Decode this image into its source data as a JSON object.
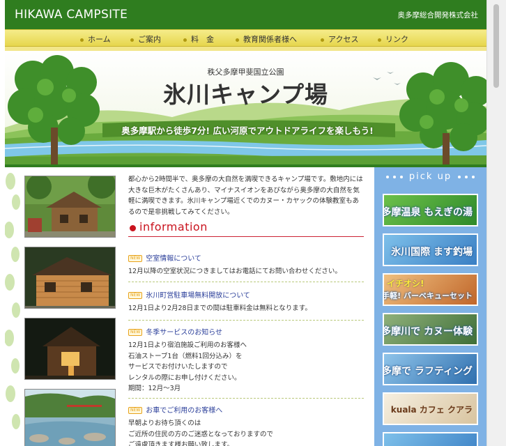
{
  "header": {
    "site_title": "HIKAWA CAMPSITE",
    "company": "奥多摩総合開発株式会社"
  },
  "nav": [
    {
      "label": "ホーム"
    },
    {
      "label": "ご案内"
    },
    {
      "label": "料　金"
    },
    {
      "label": "教育関係者様へ"
    },
    {
      "label": "アクセス"
    },
    {
      "label": "リンク"
    }
  ],
  "banner": {
    "park": "秩父多摩甲斐国立公園",
    "name": "氷川キャンプ場",
    "tagline": "奥多摩駅から徒歩7分! 広い河原でアウトドアライフを楽しもう!"
  },
  "main": {
    "intro": "都心から2時間半で、奥多摩の大自然を満喫できるキャンプ場です。敷地内には大きな巨木がたくさんあり、マイナスイオンをあびながら奥多摩の大自然を気軽に満喫できます。氷川キャンプ場近くでのカヌー・カヤックの体験教室もあるので是非挑戦してみてください。",
    "info_heading": "information",
    "badge": "NEW",
    "news": [
      {
        "title": "空室情報について",
        "body": [
          "12月以降の空室状況につきましてはお電話にてお問い合わせください。"
        ]
      },
      {
        "title": "氷川町営駐車場無料開放について",
        "body": [
          "12月1日より2月28日までの間は駐車料金は無料となります。"
        ]
      },
      {
        "title": "冬季サービスのお知らせ",
        "body": [
          "12月1日より宿泊施設ご利用のお客様へ",
          "石油ストーブ1台（燃料1回分込み）を",
          "サービスでお付けいたしますので",
          "レンタルの際にお申し付けください。",
          "期間：12月〜3月"
        ]
      },
      {
        "title": "お車でご利用のお客様へ",
        "body": [
          "早朝よりお待ち頂くのは",
          "ご近所の住民の方のご迷惑となっておりますので",
          "ご遠慮頂きます様お願い致します。"
        ]
      }
    ]
  },
  "pickup": {
    "heading": "pick up",
    "items": [
      {
        "label": "奥多摩温泉 もえぎの湯",
        "color": "#3f9a38"
      },
      {
        "label": "氷川国際 ます釣場",
        "color": "#4f8fcf"
      },
      {
        "label": "お手軽! バーベキューセット",
        "sub": "イチオシ!",
        "color": "#d9803a"
      },
      {
        "label": "多摩川で カヌー体験",
        "color": "#5d8a48"
      },
      {
        "label": "奥多摩で ラフティング",
        "color": "#3f7fbf"
      },
      {
        "label": "kuala カフェ クアラ",
        "color": "#9a5a2a"
      }
    ]
  },
  "colors": {
    "header_green": "#2f7d1f",
    "nav_yellow": "#f5ec8a",
    "info_red": "#c9131e",
    "link_blue": "#2b3f9a",
    "pickup_blue": "#7fb2e5"
  }
}
